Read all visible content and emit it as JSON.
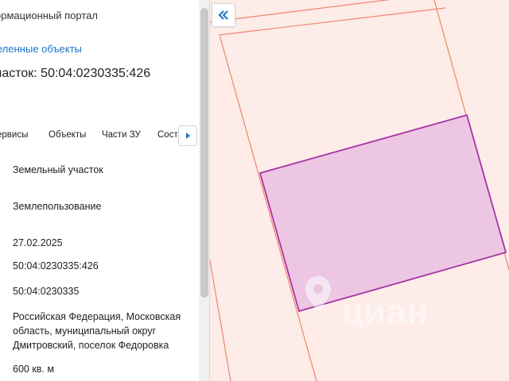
{
  "panel": {
    "portal_title": "ормационный портал",
    "selected_link": "еленные объекты",
    "parcel_heading": "часток: 50:04:0230335:426",
    "tabs": [
      {
        "label": "ервисы"
      },
      {
        "label": "Объекты"
      },
      {
        "label": "Части ЗУ"
      },
      {
        "label": "Соста"
      }
    ],
    "fields": {
      "object_type": "Земельный участок",
      "ownership_type": "Землепользование",
      "date": "27.02.2025",
      "cadastral_number": "50:04:0230335:426",
      "quarter_number": "50:04:0230335",
      "address": "Российская Федерация, Московская область, муниципальный округ Дмитровский, поселок Федоровка",
      "area": "600 кв. м"
    }
  },
  "map": {
    "parcel_fill": "#ecc6e2",
    "parcel_stroke": "#a832a8",
    "background_fill": "#fdece8",
    "boundary_stroke": "#f0866a",
    "watermark_icon": "location-pin-icon",
    "watermark_text": "циан"
  },
  "controls": {
    "collapse_icon": "double-chevron-left-icon",
    "tabs_next_icon": "triangle-right-icon"
  }
}
